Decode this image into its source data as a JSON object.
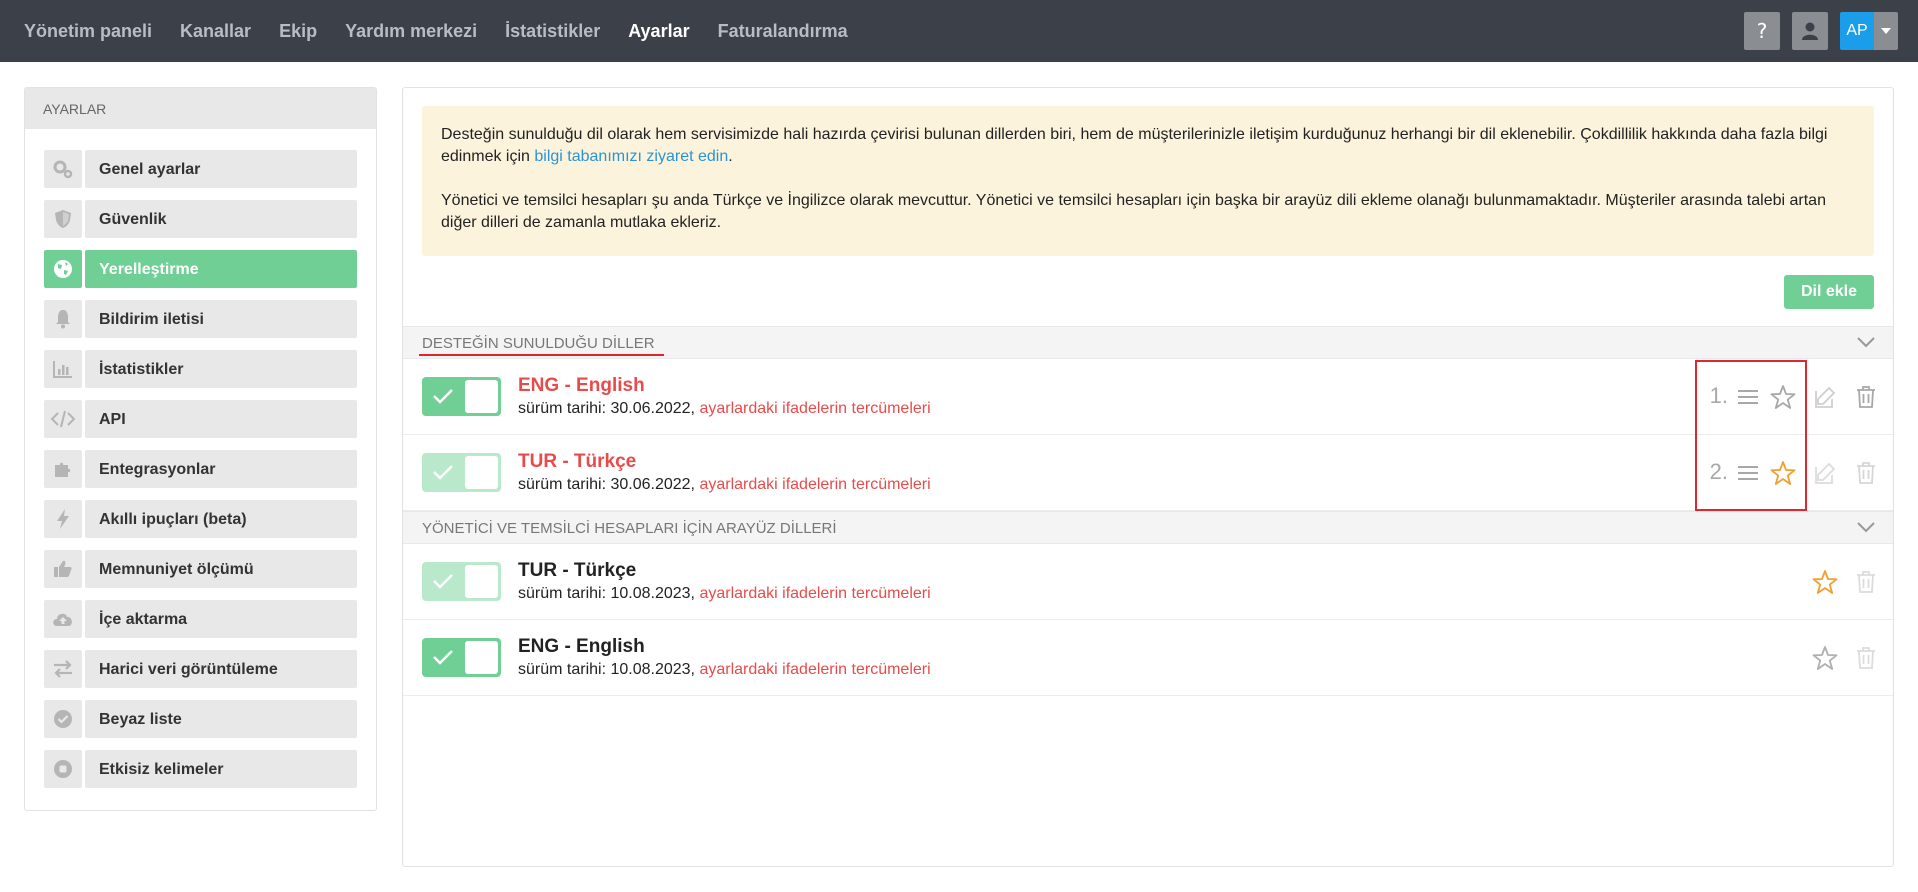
{
  "nav": {
    "items": [
      "Yönetim paneli",
      "Kanallar",
      "Ekip",
      "Yardım merkezi",
      "İstatistikler",
      "Ayarlar",
      "Faturalandırma"
    ],
    "active": "Ayarlar",
    "help_icon": "question-icon",
    "user_icon": "user-icon",
    "avatar_initials": "AP"
  },
  "sidebar": {
    "header": "AYARLAR",
    "items": [
      {
        "label": "Genel ayarlar",
        "icon": "gears-icon"
      },
      {
        "label": "Güvenlik",
        "icon": "shield-icon"
      },
      {
        "label": "Yerelleştirme",
        "icon": "globe-icon",
        "active": true
      },
      {
        "label": "Bildirim iletisi",
        "icon": "bell-icon"
      },
      {
        "label": "İstatistikler",
        "icon": "bar-chart-icon"
      },
      {
        "label": "API",
        "icon": "code-icon"
      },
      {
        "label": "Entegrasyonlar",
        "icon": "puzzle-icon"
      },
      {
        "label": "Akıllı ipuçları (beta)",
        "icon": "lightning-icon"
      },
      {
        "label": "Memnuniyet ölçümü",
        "icon": "thumbs-up-icon"
      },
      {
        "label": "İçe aktarma",
        "icon": "cloud-upload-icon"
      },
      {
        "label": "Harici veri görüntüleme",
        "icon": "exchange-icon"
      },
      {
        "label": "Beyaz liste",
        "icon": "check-circle-icon"
      },
      {
        "label": "Etkisiz kelimeler",
        "icon": "stop-circle-icon"
      }
    ]
  },
  "notice": {
    "p1_text": "Desteğin sunulduğu dil olarak hem servisimizde hali hazırda çevirisi bulunan dillerden biri, hem de müşterilerinizle iletişim kurduğunuz herhangi bir dil eklenebilir. Çokdillilik hakkında daha fazla bilgi edinmek için ",
    "p1_link": "bilgi tabanımızı ziyaret edin",
    "p1_end": ".",
    "p2_text": "Yönetici ve temsilci hesapları şu anda Türkçe ve İngilizce olarak mevcuttur. Yönetici ve temsilci hesapları için başka bir arayüz dili ekleme olanağı bulunmamaktadır. Müşteriler arasında talebi artan diğer dilleri de zamanla mutlaka ekleriz."
  },
  "add_button": "Dil ekle",
  "support_section": {
    "title": "DESTEĞİN SUNULDUĞU DİLLER",
    "languages": [
      {
        "name": "ENG - English",
        "date_prefix": "sürüm tarihi: 30.06.2022, ",
        "link": "ayarlardaki ifadelerin tercümeleri",
        "order": "1.",
        "enabled": true,
        "starred": false
      },
      {
        "name": "TUR - Türkçe",
        "date_prefix": "sürüm tarihi: 30.06.2022, ",
        "link": "ayarlardaki ifadelerin tercümeleri",
        "order": "2.",
        "enabled": true,
        "starred": true
      }
    ]
  },
  "interface_section": {
    "title": "YÖNETİCİ VE TEMSİLCİ HESAPLARI İÇİN ARAYÜZ DİLLERİ",
    "languages": [
      {
        "name": "TUR - Türkçe",
        "date_prefix": "sürüm tarihi: 10.08.2023, ",
        "link": "ayarlardaki ifadelerin tercümeleri",
        "enabled": true,
        "starred": true
      },
      {
        "name": "ENG - English",
        "date_prefix": "sürüm tarihi: 10.08.2023, ",
        "link": "ayarlardaki ifadelerin tercümeleri",
        "enabled": true,
        "starred": false
      }
    ]
  },
  "colors": {
    "topbar": "#3b4049",
    "accent_green": "#6fcf95",
    "link_red": "#e84b4b",
    "star_orange": "#f0a030",
    "notice_bg": "#fcf3dc",
    "highlight": "#e0262f"
  }
}
